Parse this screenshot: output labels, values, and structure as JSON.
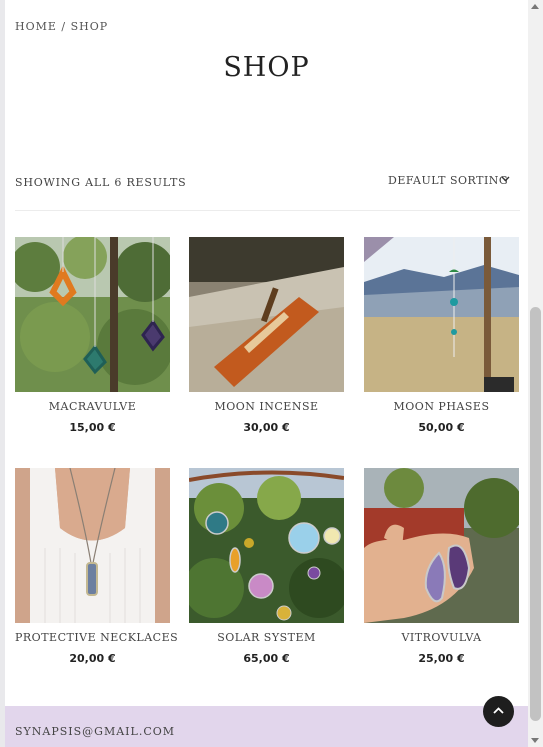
{
  "breadcrumb": {
    "home": "HOME",
    "separator": " / ",
    "current": "SHOP"
  },
  "title": "SHOP",
  "result_count": "SHOWING ALL 6 RESULTS",
  "sorting": {
    "selected": "DEFAULT SORTING"
  },
  "products": [
    {
      "name": "MACRAVULVE",
      "price": "15,00 €"
    },
    {
      "name": "MOON INCENSE",
      "price": "30,00 €"
    },
    {
      "name": "MOON PHASES",
      "price": "50,00 €"
    },
    {
      "name": "PROTECTIVE NECKLACES",
      "price": "20,00 €"
    },
    {
      "name": "SOLAR SYSTEM",
      "price": "65,00 €"
    },
    {
      "name": "VITROVULVA",
      "price": "25,00 €"
    }
  ],
  "footer": {
    "email": "SYNAPSIS@GMAIL.COM"
  },
  "colors": {
    "footer_bg": "#e2d6ec",
    "accent_dark": "#1e1e1e"
  }
}
